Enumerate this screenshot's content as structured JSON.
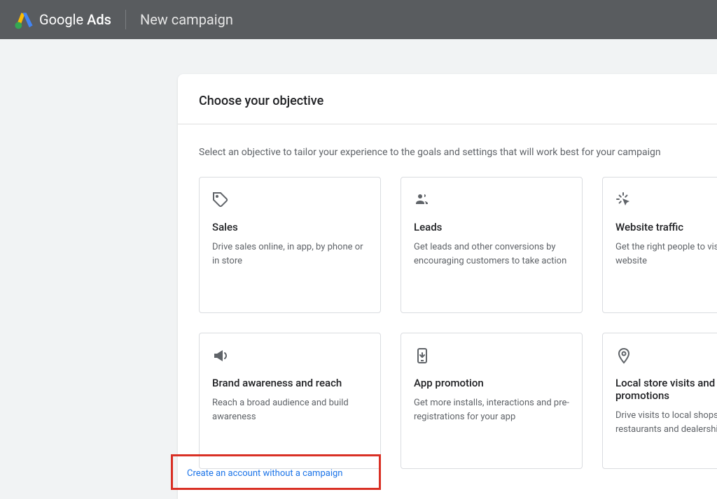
{
  "header": {
    "logo_text_normal": "Google",
    "logo_text_bold": "Ads",
    "page_title": "New campaign"
  },
  "main": {
    "card_title": "Choose your objective",
    "description": "Select an objective to tailor your experience to the goals and settings that will work best for your campaign",
    "objectives": [
      {
        "icon": "tag",
        "title": "Sales",
        "desc": "Drive sales online, in app, by phone or in store"
      },
      {
        "icon": "people",
        "title": "Leads",
        "desc": "Get leads and other conversions by encouraging customers to take action"
      },
      {
        "icon": "click",
        "title": "Website traffic",
        "desc": "Get the right people to visit your website"
      },
      {
        "icon": "megaphone",
        "title": "Brand awareness and reach",
        "desc": "Reach a broad audience and build awareness"
      },
      {
        "icon": "phone-download",
        "title": "App promotion",
        "desc": "Get more installs, interactions and pre-registrations for your app"
      },
      {
        "icon": "location",
        "title": "Local store visits and promotions",
        "desc": "Drive visits to local shops, including restaurants and dealerships"
      }
    ],
    "skip_link": "Create an account without a campaign"
  }
}
